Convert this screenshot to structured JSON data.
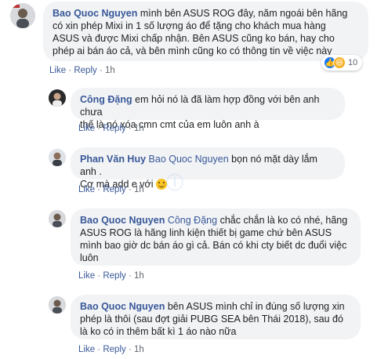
{
  "comments": [
    {
      "author": "Bao Quoc Nguyen",
      "lines": [
        "mình bên ASUS ROG đây, năm ngoái bên hãng",
        "có xin phép Mixi in 1 số lượng áo để tặng cho khách mua hàng",
        "ASUS và được Mixi chấp nhận. Bên ASUS cũng ko bán, hay cho",
        "phép ai bán áo cả, và bên mình cũng ko có thông tin về việc này"
      ],
      "actions": {
        "like": "Like",
        "reply": "Reply",
        "time": "1h"
      },
      "reactions": {
        "count": "10",
        "icons": [
          "like-reaction-icon",
          "haha-reaction-icon"
        ]
      }
    },
    {
      "author": "Công Đặng",
      "lines": [
        "em hỏi nó là đã làm hợp đồng với bên anh chưa",
        "thế là nó xóa cmn cmt của em luôn anh à"
      ],
      "actions": {
        "like": "Like",
        "reply": "Reply",
        "time": "1h"
      }
    },
    {
      "author": "Phan Văn Huy",
      "tag": "Bao Quoc Nguyen",
      "lines": [
        "bọn nó mặt dày lắm anh .",
        "Cơ mà add e với"
      ],
      "actions": {
        "like": "Like",
        "reply": "Reply",
        "time": "1h"
      }
    },
    {
      "author": "Bao Quoc Nguyen",
      "tag": "Công Đặng",
      "lines": [
        "chắc chắn là ko có nhé, hãng",
        "ASUS ROG là hãng linh kiện thiết bị game chứ bên ASUS",
        "mình bao giờ dc bán áo gì cả. Bán có khi cty biết dc đuổi việc",
        "luôn"
      ],
      "actions": {
        "like": "Like",
        "reply": "Reply",
        "time": "1h"
      }
    },
    {
      "author": "Bao Quoc Nguyen",
      "lines": [
        "bên ASUS mình chỉ in đúng số lượng xin",
        "phép là thôi (sau đợt giải PUBG SEA bên Thái 2018), sau đó",
        "là ko có in thêm bất kì 1 áo nào nữa"
      ],
      "actions": {
        "like": "Like",
        "reply": "Reply",
        "time": "1h"
      }
    }
  ],
  "colors": {
    "link": "#385898",
    "bubble": "#f2f3f5",
    "meta": "#606770"
  }
}
